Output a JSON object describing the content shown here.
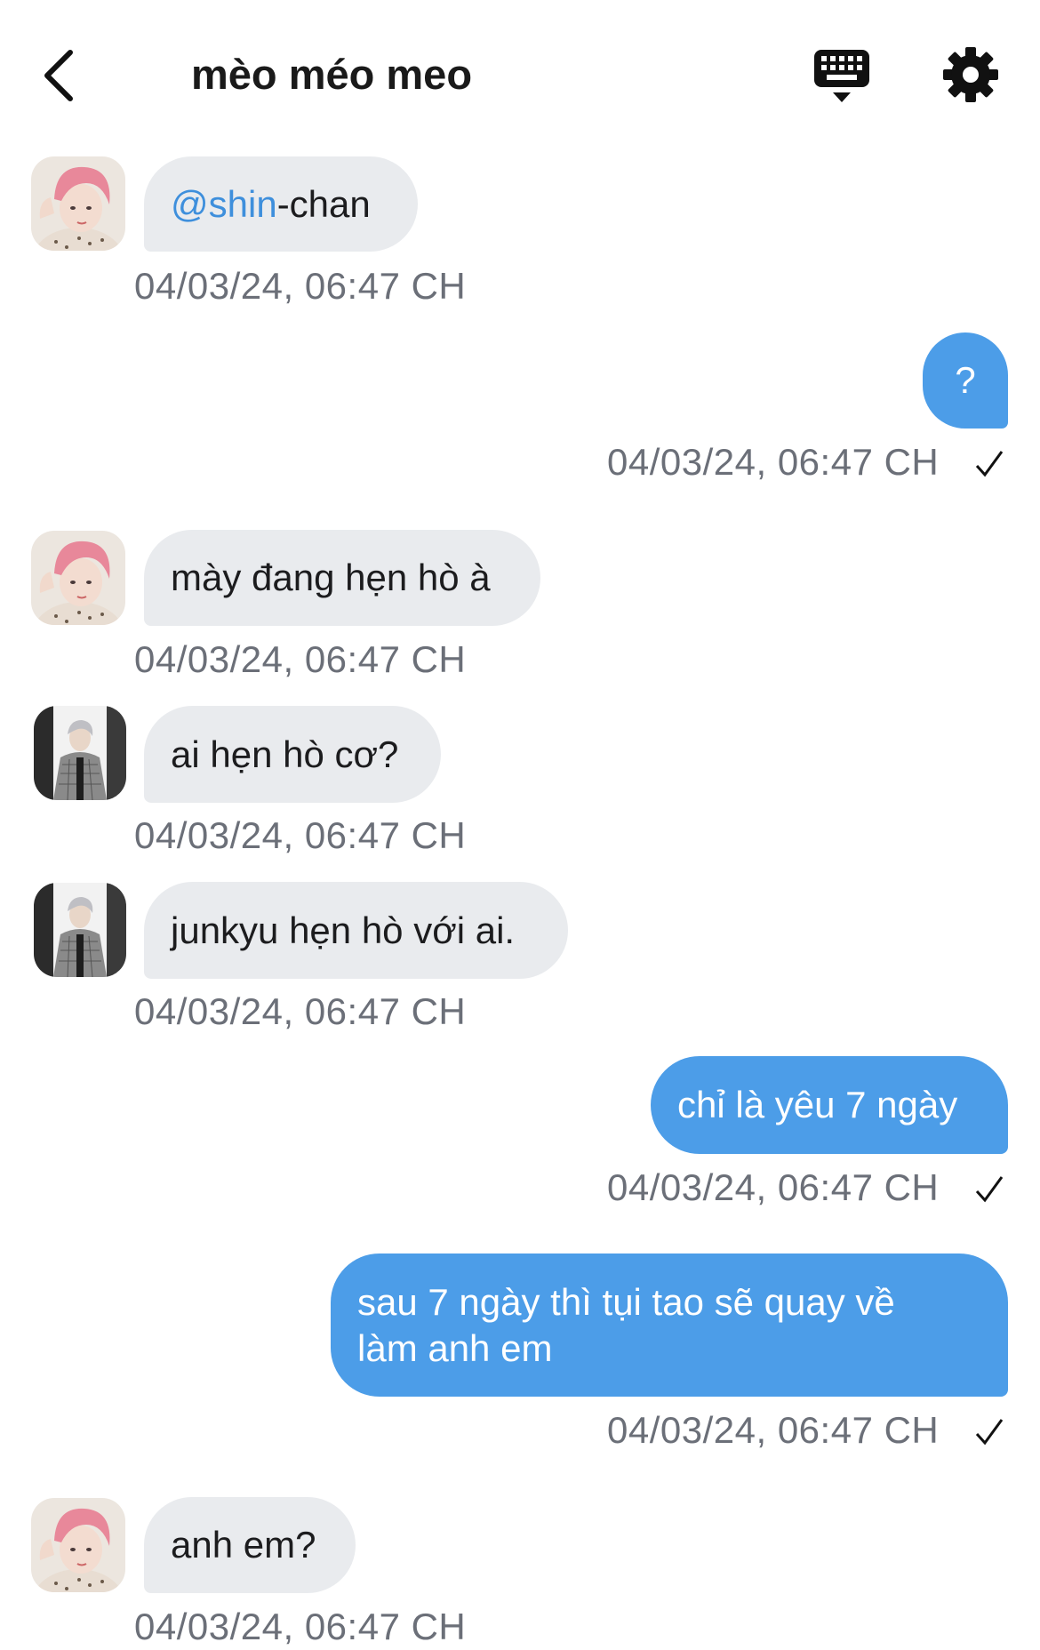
{
  "header": {
    "title": "mèo méo meo",
    "back_icon": "chevron-left-icon",
    "keyboard_icon": "keyboard-icon",
    "settings_icon": "gear-icon"
  },
  "messages": [
    {
      "id": "m1",
      "direction": "incoming",
      "sender_avatar": "pink-hair-avatar",
      "mention": "@shin",
      "text": "-chan",
      "timestamp": "04/03/24, 06:47 CH"
    },
    {
      "id": "m2",
      "direction": "outgoing",
      "text": "?",
      "timestamp": "04/03/24, 06:47 CH",
      "status": "sent"
    },
    {
      "id": "m3",
      "direction": "incoming",
      "sender_avatar": "pink-hair-avatar",
      "text": "mày đang hẹn hò à",
      "timestamp": "04/03/24, 06:47 CH"
    },
    {
      "id": "m4",
      "direction": "incoming",
      "sender_avatar": "gray-hair-avatar",
      "text": "ai hẹn hò cơ?",
      "timestamp": "04/03/24, 06:47 CH"
    },
    {
      "id": "m5",
      "direction": "incoming",
      "sender_avatar": "gray-hair-avatar",
      "text": "junkyu hẹn hò với ai.",
      "timestamp": "04/03/24, 06:47 CH"
    },
    {
      "id": "m6",
      "direction": "outgoing",
      "text": "chỉ là yêu 7 ngày",
      "timestamp": "04/03/24, 06:47 CH",
      "status": "sent"
    },
    {
      "id": "m7",
      "direction": "outgoing",
      "text": "sau 7 ngày thì tụi tao sẽ quay về làm anh em",
      "timestamp": "04/03/24, 06:47 CH",
      "status": "sent"
    },
    {
      "id": "m8",
      "direction": "incoming",
      "sender_avatar": "pink-hair-avatar",
      "text": "anh em?",
      "timestamp": "04/03/24, 06:47 CH"
    }
  ],
  "colors": {
    "outgoing_bubble": "#4c9de8",
    "incoming_bubble": "#e9ebee",
    "mention": "#3e8fdc",
    "timestamp": "#6b6f78"
  }
}
